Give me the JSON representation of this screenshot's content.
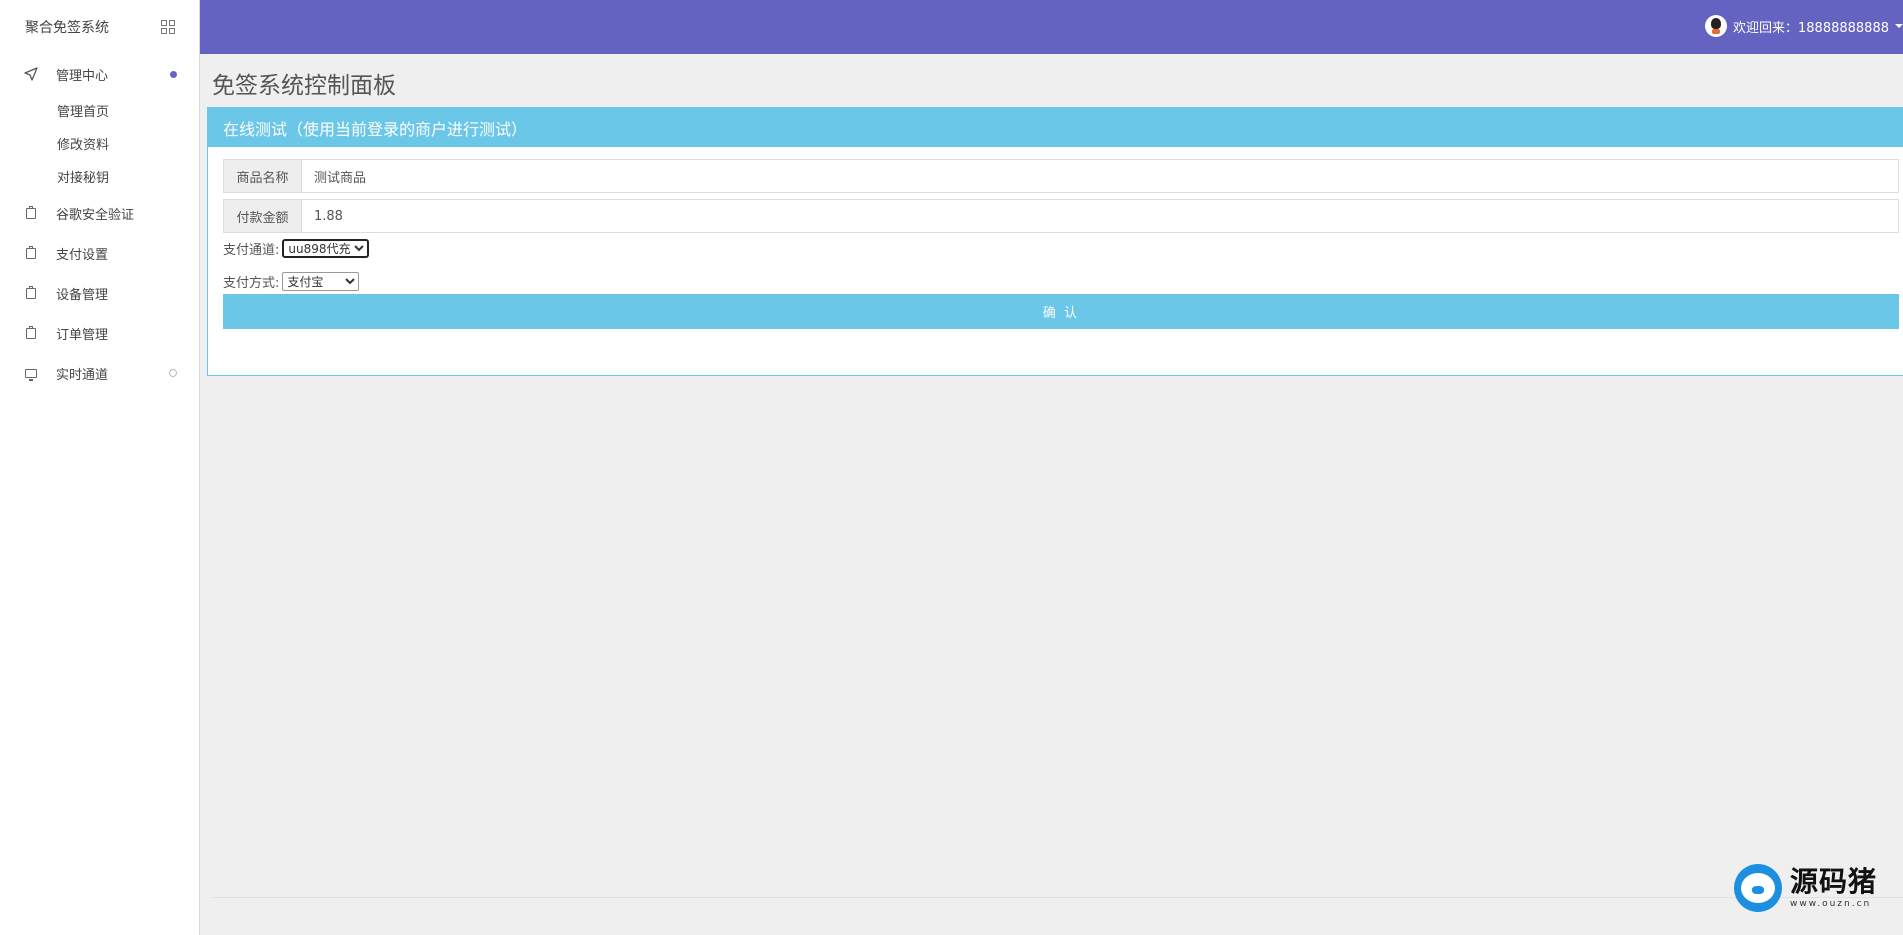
{
  "app": {
    "title": "聚合免签系统"
  },
  "sidebar": {
    "group": {
      "label": "管理中心"
    },
    "subitems": [
      {
        "label": "管理首页"
      },
      {
        "label": "修改资料"
      },
      {
        "label": "对接秘钥"
      }
    ],
    "items": [
      {
        "label": "谷歌安全验证"
      },
      {
        "label": "支付设置"
      },
      {
        "label": "设备管理"
      },
      {
        "label": "订单管理"
      },
      {
        "label": "实时通道"
      }
    ]
  },
  "header": {
    "welcome": "欢迎回来：18888888888"
  },
  "main": {
    "page_title": "免签系统控制面板",
    "panel_title": "在线测试（使用当前登录的商户进行测试）",
    "product_label": "商品名称",
    "product_value": "测试商品",
    "amount_label": "付款金额",
    "amount_value": "1.88",
    "channel_label": "支付通道:",
    "channel_value": "uu898代充",
    "method_label": "支付方式:",
    "method_value": "支付宝",
    "confirm_label": "确 认"
  },
  "watermark": {
    "name": "源码猪",
    "url": "www.ouzn.cn"
  },
  "colors": {
    "accent": "#6463c1",
    "panel": "#6bc7e8",
    "background": "#efefef"
  }
}
